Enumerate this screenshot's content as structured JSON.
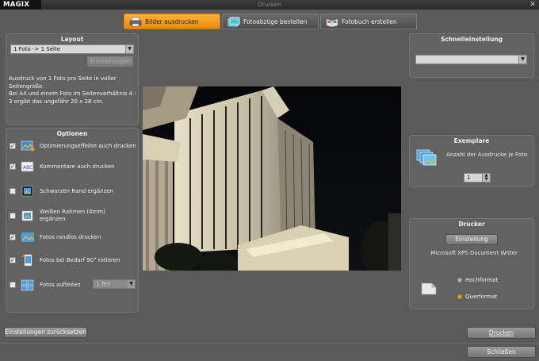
{
  "window": {
    "logo": "MAGIX",
    "title": "Drucken",
    "close_glyph": "✕"
  },
  "tabs": [
    {
      "label": "Bilder ausdrucken",
      "icon": "printer-icon",
      "active": true
    },
    {
      "label": "Fotoabzüge bestellen",
      "icon": "photo-order-icon",
      "active": false
    },
    {
      "label": "Fotobuch erstellen",
      "icon": "photobook-icon",
      "active": false
    }
  ],
  "layout": {
    "title": "Layout",
    "select_value": "1 Foto  -> 1 Seite",
    "settings_button": "Einstellungen",
    "description": "Ausdruck von 1 Foto pro Seite in voller Seitengröße.\nBei A4 und einem Foto im Seitenverhältnis 4 : 3 ergibt das ungefähr 20 x 28 cm."
  },
  "options": {
    "title": "Optionen",
    "items": [
      {
        "label": "Optimierungseffekte auch drucken",
        "checked": true,
        "icon": "effects-icon"
      },
      {
        "label": "Kommentare auch drucken",
        "checked": true,
        "icon": "comment-icon"
      },
      {
        "label": "Schwarzen Rand ergänzen",
        "checked": false,
        "icon": "black-border-icon"
      },
      {
        "label": "Weißen Rahmen (4mm) ergänzen",
        "checked": false,
        "icon": "white-frame-icon"
      },
      {
        "label": "Fotos randlos drucken",
        "checked": true,
        "icon": "borderless-icon"
      },
      {
        "label": "Fotos bei Bedarf 90° rotieren",
        "checked": true,
        "icon": "rotate-icon"
      },
      {
        "label": "Fotos aufteilen",
        "checked": false,
        "icon": "split-icon"
      }
    ],
    "split_select": "1 Teil"
  },
  "quick": {
    "title": "Schnelleinstellung",
    "select_value": ""
  },
  "copies": {
    "title": "Exemplare",
    "label": "Anzahl der Ausdrucke je Foto:",
    "value": "1"
  },
  "printer": {
    "title": "Drucker",
    "settings_button": "Einstellung",
    "name": "Microsoft XPS Document Writer",
    "orientation": [
      {
        "label": "Hochformat",
        "selected": false
      },
      {
        "label": "Querformat",
        "selected": true
      }
    ]
  },
  "buttons": {
    "reset": "Einstellungen zurücksetzen",
    "print": "Drucken",
    "close": "Schließen"
  },
  "colors": {
    "accent": "#f0a020",
    "background": "#5a5a5a"
  }
}
